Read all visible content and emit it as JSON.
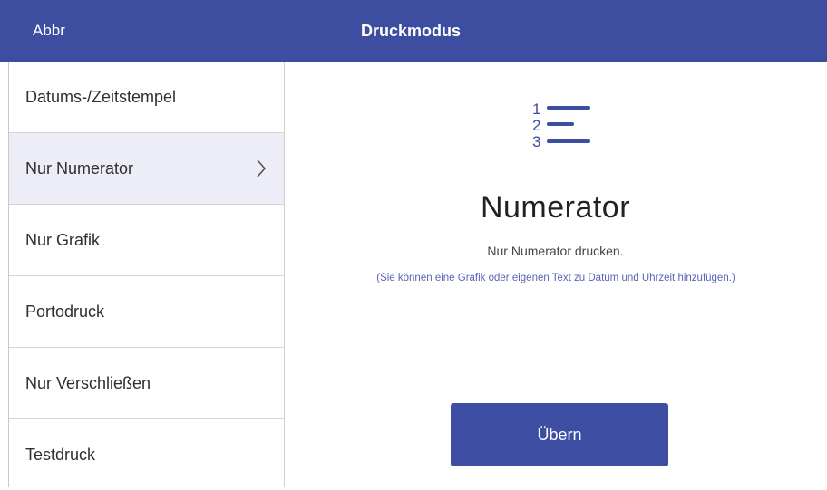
{
  "header": {
    "back_label": "Abbr",
    "title": "Druckmodus"
  },
  "sidebar": {
    "items": [
      {
        "label": "Datums-/Zeitstempel",
        "active": false
      },
      {
        "label": "Nur Numerator",
        "active": true
      },
      {
        "label": "Nur Grafik",
        "active": false
      },
      {
        "label": "Portodruck",
        "active": false
      },
      {
        "label": "Nur Verschließen",
        "active": false
      },
      {
        "label": "Testdruck",
        "active": false
      }
    ]
  },
  "main": {
    "icon": "numbered-list-icon",
    "icon_numbers": [
      "1",
      "2",
      "3"
    ],
    "heading": "Numerator",
    "subtitle": "Nur Numerator drucken.",
    "hint": "(Sie können eine Grafik oder eigenen Text zu Datum und Uhrzeit hinzufügen.)",
    "apply_label": "Übern"
  },
  "colors": {
    "primary": "#3d4da0",
    "active_item_bg": "#ecedf6",
    "hint_text": "#5a63b8"
  }
}
